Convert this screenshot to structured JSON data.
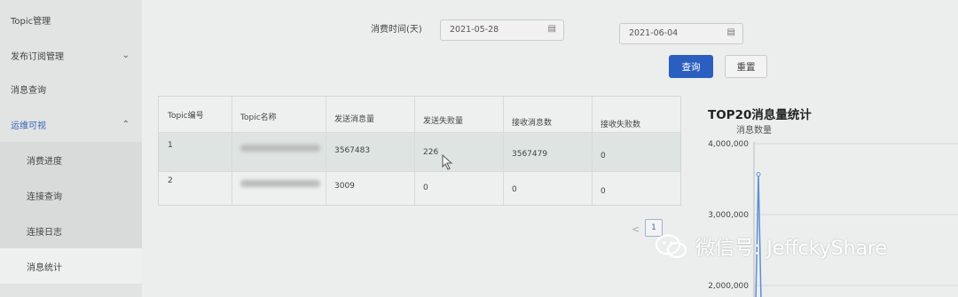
{
  "sidebar": {
    "items": [
      {
        "label": "Topic管理"
      },
      {
        "label": "发布订阅管理"
      },
      {
        "label": "消息查询"
      },
      {
        "label": "运维可视"
      },
      {
        "label": "消费进度"
      },
      {
        "label": "连接查询"
      },
      {
        "label": "连接日志"
      },
      {
        "label": "消息统计"
      }
    ]
  },
  "filters": {
    "time_label": "消费时间(天)",
    "start_date": "2021-05-28",
    "end_date": "2021-06-04",
    "query_button": "查询",
    "reset_button": "重置"
  },
  "table": {
    "headers": [
      "Topic编号",
      "Topic名称",
      "发送消息量",
      "发送失败量",
      "接收消息数",
      "接收失败数"
    ],
    "rows": [
      {
        "id": "1",
        "sent": "3567483",
        "send_failed": "226",
        "received": "3567479",
        "receive_failed": "0"
      },
      {
        "id": "2",
        "sent": "3009",
        "send_failed": "0",
        "received": "0",
        "receive_failed": "0"
      }
    ]
  },
  "pagination": {
    "prev": "<",
    "current": "1"
  },
  "chart_data": {
    "type": "line",
    "title": "TOP20消息量统计",
    "ylabel": "消息数量",
    "yticks": [
      "4,000,000",
      "3,000,000",
      "2,000,000"
    ],
    "ylim": [
      0,
      4000000
    ],
    "series": [
      {
        "values": [
          0,
          3567483,
          0
        ]
      }
    ],
    "line_color": "#5b8fd6"
  },
  "watermark": {
    "text": "微信号: JeffckyShare",
    "icon": "wechat-icon"
  }
}
